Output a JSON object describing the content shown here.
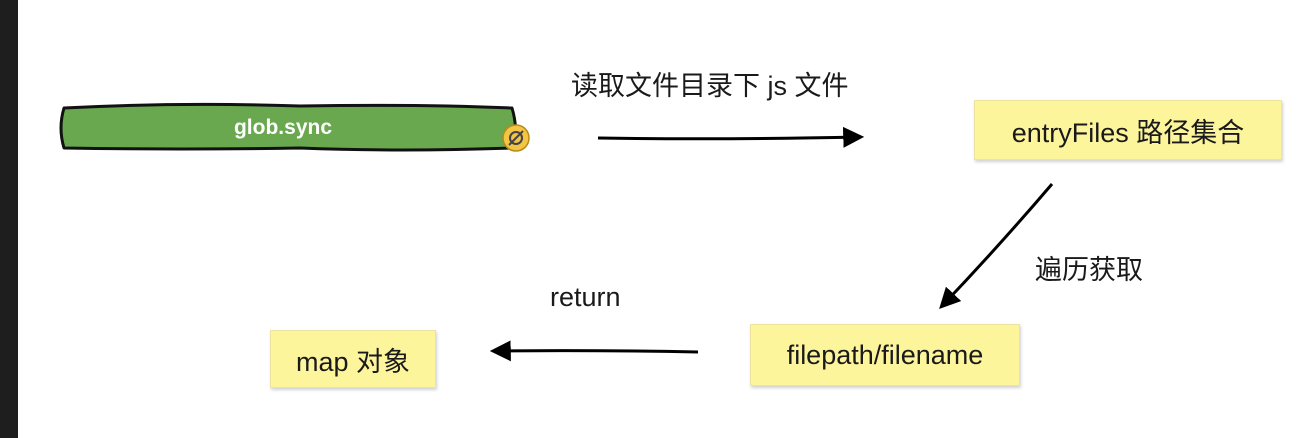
{
  "nodes": {
    "glob_sync": "glob.sync",
    "entry_files": "entryFiles 路径集合",
    "filepath": "filepath/filename",
    "map_object": "map 对象"
  },
  "edges": {
    "read_files": "读取文件目录下 js 文件",
    "traverse": "遍历获取",
    "return": "return"
  },
  "colors": {
    "glob_fill": "#6aa84f",
    "note_fill": "#fdf59c",
    "handle": "#f4c542"
  },
  "icons": {
    "glob_handle": "link-icon"
  }
}
